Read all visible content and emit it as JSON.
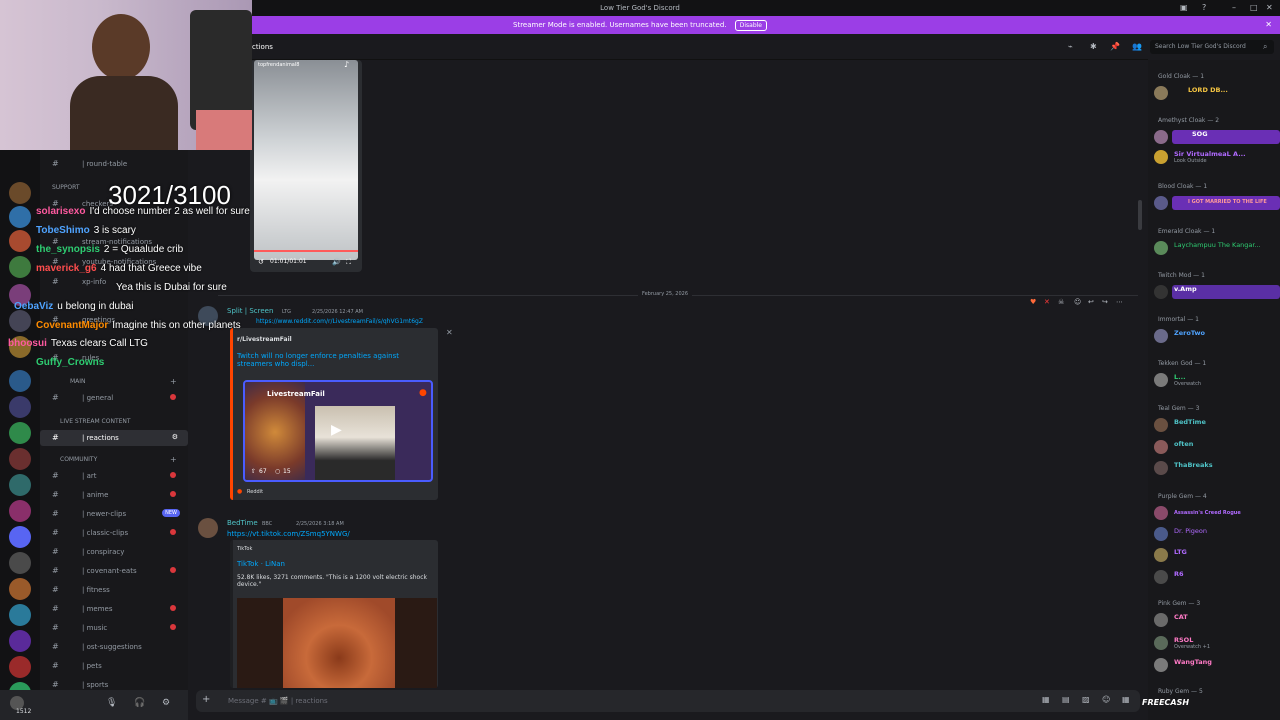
{
  "window": {
    "title": "Low Tier God's Discord"
  },
  "banner": {
    "text": "Streamer Mode is enabled. Usernames have been truncated.",
    "disable_label": "Disable"
  },
  "header": {
    "channel_name": "ctions",
    "search_placeholder": "Search Low Tier God's Discord"
  },
  "sidebar": {
    "top_channels": [
      {
        "label": "| round-table"
      },
      {
        "label": "checkers"
      },
      {
        "label": "stream-notifications"
      },
      {
        "label": "youtube-notifications"
      },
      {
        "label": "xp-info"
      },
      {
        "label": "greetings"
      },
      {
        "label": "rules"
      }
    ],
    "support_label": "SUPPORT",
    "main_label": "MAIN",
    "live_label": "LIVE STREAM CONTENT",
    "community_label": "COMMUNITY",
    "main_channels": [
      {
        "label": "| general",
        "unread": true
      }
    ],
    "live_channels": [
      {
        "label": "| reactions",
        "active": true
      }
    ],
    "community_channels": [
      {
        "label": "| art",
        "unread": true
      },
      {
        "label": "| anime",
        "unread": true
      },
      {
        "label": "| newer-clips",
        "new": true
      },
      {
        "label": "| classic-clips",
        "unread": true
      },
      {
        "label": "| conspiracy",
        "unread": false
      },
      {
        "label": "| covenant-eats",
        "unread": true
      },
      {
        "label": "| fitness",
        "unread": false
      },
      {
        "label": "| memes",
        "unread": true
      },
      {
        "label": "| music",
        "unread": true
      },
      {
        "label": "| ost-suggestions",
        "unread": false
      },
      {
        "label": "| pets",
        "unread": false
      },
      {
        "label": "| sports",
        "unread": false
      }
    ],
    "new_label": "NEW",
    "user_count": "1512"
  },
  "messages": {
    "date_divider": "February 25, 2026",
    "video1": {
      "handle": "topfrendanimal8",
      "time": "01:01/01:01"
    },
    "msg1": {
      "author": "Split | Screen",
      "tags": "LTG",
      "timestamp": "2/25/2026 12:47 AM",
      "link": "https://www.reddit.com/r/LivestreamFail/s/qhVG1mt6gZ",
      "embed_provider": "r/LivestreamFail",
      "embed_title": "Twitch will no longer enforce penalties against streamers who displ...",
      "embed_image_title": "LivestreamFail",
      "upvotes": "67",
      "comments": "15",
      "footer": "Reddit"
    },
    "msg2": {
      "author": "BedTime",
      "tags": "BBC",
      "timestamp": "2/25/2026 3:18 AM",
      "link": "https://vt.tiktok.com/ZSmq5YNWG/",
      "embed_provider": "TikTok",
      "embed_title": "TikTok · LiNan",
      "embed_desc": "52.8K likes, 3271 comments. \"This is a 1200 volt electric shock device.\""
    }
  },
  "composer": {
    "placeholder": "Message # 📺 🎬 | reactions"
  },
  "members": {
    "groups": [
      {
        "role": "Gold Cloak — 1",
        "members": [
          {
            "name": "LORD DB...",
            "color": "#f5c542",
            "status": ""
          }
        ]
      },
      {
        "role": "Amethyst Cloak — 2",
        "members": [
          {
            "name": "SOG",
            "color": "#b06aff",
            "status": "",
            "hl": "#6a2fb5"
          },
          {
            "name": "Sir VirtualmeaL A...",
            "color": "#b06aff",
            "status": "Look Outside",
            "hl": ""
          }
        ]
      },
      {
        "role": "Blood Cloak — 1",
        "members": [
          {
            "name": "I GOT MARRIED TO THE LIFE",
            "color": "#ff4d4d",
            "status": "",
            "hl": "#6a2fb5"
          }
        ]
      },
      {
        "role": "Emerald Cloak — 1",
        "members": [
          {
            "name": "Laychampuu The Kangar...",
            "color": "#2ecc71",
            "status": "",
            "hl": ""
          }
        ]
      },
      {
        "role": "Twitch Mod — 1",
        "members": [
          {
            "name": "v.Amp",
            "color": "#ffffff",
            "status": "",
            "hl": "#6a2fb5"
          }
        ]
      },
      {
        "role": "Immortal — 1",
        "members": [
          {
            "name": "ZeroTwo",
            "color": "#4fa3ff",
            "status": "",
            "hl": ""
          }
        ]
      },
      {
        "role": "Tekken God — 1",
        "members": [
          {
            "name": "L...",
            "color": "#2ecc71",
            "status": "Overwatch",
            "hl": ""
          }
        ]
      },
      {
        "role": "Teal Gem — 3",
        "members": [
          {
            "name": "BedTime",
            "color": "#4fc3c7",
            "status": "",
            "hl": ""
          },
          {
            "name": "often",
            "color": "#4fc3c7",
            "status": "",
            "hl": ""
          },
          {
            "name": "ThaBreaks",
            "color": "#4fc3c7",
            "status": "",
            "hl": "#6a2fb5"
          }
        ]
      },
      {
        "role": "Purple Gem — 4",
        "members": [
          {
            "name": "Assassin's Creed Rogue",
            "color": "#b06aff",
            "status": "",
            "hl": ""
          },
          {
            "name": "Dr. Pigeon",
            "color": "#b06aff",
            "status": "",
            "hl": ""
          },
          {
            "name": "LTG",
            "color": "#b06aff",
            "status": "",
            "hl": ""
          },
          {
            "name": "R6",
            "color": "#b06aff",
            "status": "",
            "hl": ""
          }
        ]
      },
      {
        "role": "Pink Gem — 3",
        "members": [
          {
            "name": "CAT",
            "color": "#ff7ac6",
            "status": "",
            "hl": ""
          },
          {
            "name": "RSOL",
            "color": "#ff7ac6",
            "status": "Overwatch +1",
            "hl": ""
          },
          {
            "name": "WangTang",
            "color": "#ff7ac6",
            "status": "",
            "hl": ""
          }
        ]
      },
      {
        "role": "Ruby Gem — 5",
        "members": []
      }
    ]
  },
  "overlay": {
    "count": "3021/3100",
    "chat": [
      {
        "user": "solarisexo",
        "color": "#ff5aa0",
        "msg": "I'd choose number 2 as well for sure"
      },
      {
        "user": "TobeShimo",
        "color": "#4fa3ff",
        "msg": "3 is scary"
      },
      {
        "user": "the_synopsis",
        "color": "#2ecc71",
        "msg": "2 = Quaalude crib"
      },
      {
        "user": "maverick_g6",
        "color": "#ff4d4d",
        "msg": "4 had that Greece vibe"
      },
      {
        "user": "",
        "color": "#ffffff",
        "msg": "Yea this is Dubai for sure"
      },
      {
        "user": "OebaViz",
        "color": "#4fa3ff",
        "msg": "u belong in dubai"
      },
      {
        "user": "CovenantMajor",
        "color": "#ff8c00",
        "msg": "Imagine this on other planets"
      },
      {
        "user": "bhoosui",
        "color": "#ff5aa0",
        "msg": "Texas clears Call LTG"
      },
      {
        "user": "Guffy_Crowns",
        "color": "#2ecc71",
        "msg": ""
      }
    ],
    "brand": "FREECASH"
  }
}
